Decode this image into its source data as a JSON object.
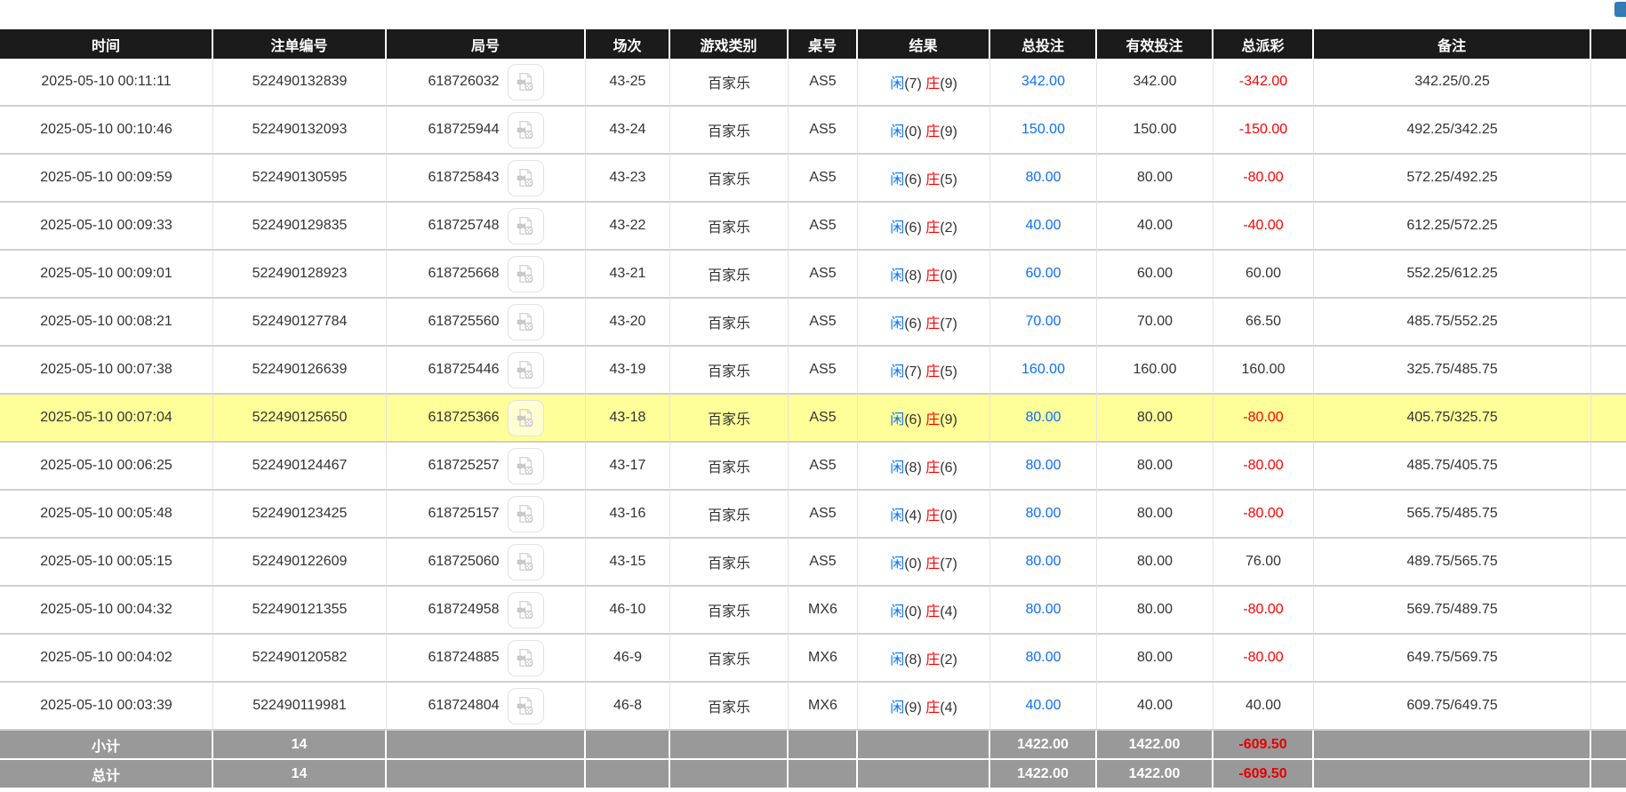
{
  "topbar": {
    "partial_button_color": "#337ab7"
  },
  "colors": {
    "header_bg": "#1b1b1b",
    "header_text": "#ffffff",
    "row_bg": "#ffffff",
    "row_border": "#cfcfcf",
    "cell_border": "#e3e3e3",
    "highlight_row_bg": "#ffff99",
    "summary_bg": "#999999",
    "link_blue": "#0d6efd",
    "negative_red": "#ff0000",
    "summary_negative_red": "#e60000"
  },
  "table": {
    "columns": [
      {
        "key": "time",
        "label": "时间"
      },
      {
        "key": "bet_no",
        "label": "注单编号"
      },
      {
        "key": "round_no",
        "label": "局号"
      },
      {
        "key": "session",
        "label": "场次"
      },
      {
        "key": "game_type",
        "label": "游戏类别"
      },
      {
        "key": "table_no",
        "label": "桌号"
      },
      {
        "key": "result",
        "label": "结果"
      },
      {
        "key": "total_bet",
        "label": "总投注"
      },
      {
        "key": "valid_bet",
        "label": "有效投注"
      },
      {
        "key": "payout",
        "label": "总派彩"
      },
      {
        "key": "remark",
        "label": "备注"
      },
      {
        "key": "extra",
        "label": ""
      }
    ],
    "icons": {
      "round_cell_icon": "video-replay-file"
    },
    "rows": [
      {
        "time": "2025-05-10 00:11:11",
        "bet_no": "522490132839",
        "round_no": "618726032",
        "session": "43-25",
        "game_type": "百家乐",
        "table_no": "AS5",
        "result": {
          "player": "闲",
          "player_pts": "(7)",
          "banker": "庄",
          "banker_pts": "(9)"
        },
        "total_bet": "342.00",
        "valid_bet": "342.00",
        "payout": "-342.00",
        "remark": "342.25/0.25",
        "highlight": false
      },
      {
        "time": "2025-05-10 00:10:46",
        "bet_no": "522490132093",
        "round_no": "618725944",
        "session": "43-24",
        "game_type": "百家乐",
        "table_no": "AS5",
        "result": {
          "player": "闲",
          "player_pts": "(0)",
          "banker": "庄",
          "banker_pts": "(9)"
        },
        "total_bet": "150.00",
        "valid_bet": "150.00",
        "payout": "-150.00",
        "remark": "492.25/342.25",
        "highlight": false
      },
      {
        "time": "2025-05-10 00:09:59",
        "bet_no": "522490130595",
        "round_no": "618725843",
        "session": "43-23",
        "game_type": "百家乐",
        "table_no": "AS5",
        "result": {
          "player": "闲",
          "player_pts": "(6)",
          "banker": "庄",
          "banker_pts": "(5)"
        },
        "total_bet": "80.00",
        "valid_bet": "80.00",
        "payout": "-80.00",
        "remark": "572.25/492.25",
        "highlight": false
      },
      {
        "time": "2025-05-10 00:09:33",
        "bet_no": "522490129835",
        "round_no": "618725748",
        "session": "43-22",
        "game_type": "百家乐",
        "table_no": "AS5",
        "result": {
          "player": "闲",
          "player_pts": "(6)",
          "banker": "庄",
          "banker_pts": "(2)"
        },
        "total_bet": "40.00",
        "valid_bet": "40.00",
        "payout": "-40.00",
        "remark": "612.25/572.25",
        "highlight": false
      },
      {
        "time": "2025-05-10 00:09:01",
        "bet_no": "522490128923",
        "round_no": "618725668",
        "session": "43-21",
        "game_type": "百家乐",
        "table_no": "AS5",
        "result": {
          "player": "闲",
          "player_pts": "(8)",
          "banker": "庄",
          "banker_pts": "(0)"
        },
        "total_bet": "60.00",
        "valid_bet": "60.00",
        "payout": "60.00",
        "remark": "552.25/612.25",
        "highlight": false
      },
      {
        "time": "2025-05-10 00:08:21",
        "bet_no": "522490127784",
        "round_no": "618725560",
        "session": "43-20",
        "game_type": "百家乐",
        "table_no": "AS5",
        "result": {
          "player": "闲",
          "player_pts": "(6)",
          "banker": "庄",
          "banker_pts": "(7)"
        },
        "total_bet": "70.00",
        "valid_bet": "70.00",
        "payout": "66.50",
        "remark": "485.75/552.25",
        "highlight": false
      },
      {
        "time": "2025-05-10 00:07:38",
        "bet_no": "522490126639",
        "round_no": "618725446",
        "session": "43-19",
        "game_type": "百家乐",
        "table_no": "AS5",
        "result": {
          "player": "闲",
          "player_pts": "(7)",
          "banker": "庄",
          "banker_pts": "(5)"
        },
        "total_bet": "160.00",
        "valid_bet": "160.00",
        "payout": "160.00",
        "remark": "325.75/485.75",
        "highlight": false
      },
      {
        "time": "2025-05-10 00:07:04",
        "bet_no": "522490125650",
        "round_no": "618725366",
        "session": "43-18",
        "game_type": "百家乐",
        "table_no": "AS5",
        "result": {
          "player": "闲",
          "player_pts": "(6)",
          "banker": "庄",
          "banker_pts": "(9)"
        },
        "total_bet": "80.00",
        "valid_bet": "80.00",
        "payout": "-80.00",
        "remark": "405.75/325.75",
        "highlight": true
      },
      {
        "time": "2025-05-10 00:06:25",
        "bet_no": "522490124467",
        "round_no": "618725257",
        "session": "43-17",
        "game_type": "百家乐",
        "table_no": "AS5",
        "result": {
          "player": "闲",
          "player_pts": "(8)",
          "banker": "庄",
          "banker_pts": "(6)"
        },
        "total_bet": "80.00",
        "valid_bet": "80.00",
        "payout": "-80.00",
        "remark": "485.75/405.75",
        "highlight": false
      },
      {
        "time": "2025-05-10 00:05:48",
        "bet_no": "522490123425",
        "round_no": "618725157",
        "session": "43-16",
        "game_type": "百家乐",
        "table_no": "AS5",
        "result": {
          "player": "闲",
          "player_pts": "(4)",
          "banker": "庄",
          "banker_pts": "(0)"
        },
        "total_bet": "80.00",
        "valid_bet": "80.00",
        "payout": "-80.00",
        "remark": "565.75/485.75",
        "highlight": false
      },
      {
        "time": "2025-05-10 00:05:15",
        "bet_no": "522490122609",
        "round_no": "618725060",
        "session": "43-15",
        "game_type": "百家乐",
        "table_no": "AS5",
        "result": {
          "player": "闲",
          "player_pts": "(0)",
          "banker": "庄",
          "banker_pts": "(7)"
        },
        "total_bet": "80.00",
        "valid_bet": "80.00",
        "payout": "76.00",
        "remark": "489.75/565.75",
        "highlight": false
      },
      {
        "time": "2025-05-10 00:04:32",
        "bet_no": "522490121355",
        "round_no": "618724958",
        "session": "46-10",
        "game_type": "百家乐",
        "table_no": "MX6",
        "result": {
          "player": "闲",
          "player_pts": "(0)",
          "banker": "庄",
          "banker_pts": "(4)"
        },
        "total_bet": "80.00",
        "valid_bet": "80.00",
        "payout": "-80.00",
        "remark": "569.75/489.75",
        "highlight": false
      },
      {
        "time": "2025-05-10 00:04:02",
        "bet_no": "522490120582",
        "round_no": "618724885",
        "session": "46-9",
        "game_type": "百家乐",
        "table_no": "MX6",
        "result": {
          "player": "闲",
          "player_pts": "(8)",
          "banker": "庄",
          "banker_pts": "(2)"
        },
        "total_bet": "80.00",
        "valid_bet": "80.00",
        "payout": "-80.00",
        "remark": "649.75/569.75",
        "highlight": false
      },
      {
        "time": "2025-05-10 00:03:39",
        "bet_no": "522490119981",
        "round_no": "618724804",
        "session": "46-8",
        "game_type": "百家乐",
        "table_no": "MX6",
        "result": {
          "player": "闲",
          "player_pts": "(9)",
          "banker": "庄",
          "banker_pts": "(4)"
        },
        "total_bet": "40.00",
        "valid_bet": "40.00",
        "payout": "40.00",
        "remark": "609.75/649.75",
        "highlight": false
      }
    ],
    "summary": [
      {
        "label": "小计",
        "count": "14",
        "total_bet": "1422.00",
        "valid_bet": "1422.00",
        "payout": "-609.50"
      },
      {
        "label": "总计",
        "count": "14",
        "total_bet": "1422.00",
        "valid_bet": "1422.00",
        "payout": "-609.50"
      }
    ]
  }
}
